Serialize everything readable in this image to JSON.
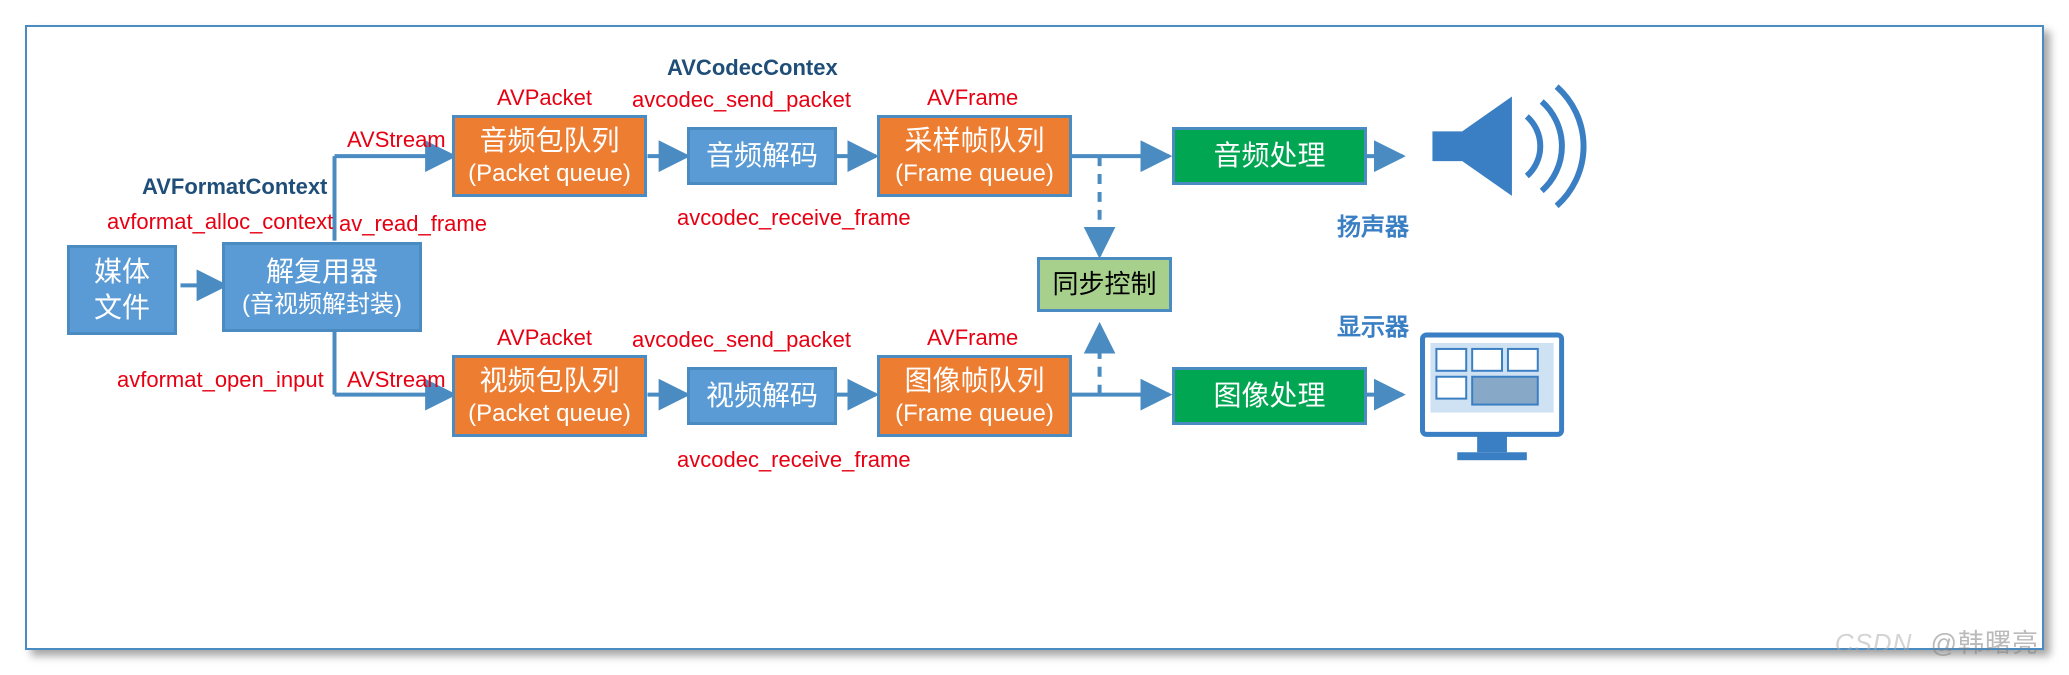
{
  "labels": {
    "avformatcontext": "AVFormatContext",
    "avformat_alloc_context": "avformat_alloc_context",
    "avformat_open_input": "avformat_open_input",
    "av_read_frame": "av_read_frame",
    "avstream_top": "AVStream",
    "avstream_bot": "AVStream",
    "avpacket_top": "AVPacket",
    "avpacket_bot": "AVPacket",
    "avcodeccontext": "AVCodecContex",
    "avcodec_send_packet_top": "avcodec_send_packet",
    "avcodec_send_packet_bot": "avcodec_send_packet",
    "avframe_top": "AVFrame",
    "avframe_bot": "AVFrame",
    "avcodec_receive_frame_top": "avcodec_receive_frame",
    "avcodec_receive_frame_bot": "avcodec_receive_frame",
    "speaker": "扬声器",
    "display": "显示器"
  },
  "boxes": {
    "media_file_l1": "媒体",
    "media_file_l2": "文件",
    "demux_l1": "解复用器",
    "demux_l2": "(音视频解封装)",
    "audio_pkt_l1": "音频包队列",
    "audio_pkt_l2": "(Packet queue)",
    "audio_decode": "音频解码",
    "audio_frame_l1": "采样帧队列",
    "audio_frame_l2": "(Frame queue)",
    "audio_proc": "音频处理",
    "video_pkt_l1": "视频包队列",
    "video_pkt_l2": "(Packet queue)",
    "video_decode": "视频解码",
    "video_frame_l1": "图像帧队列",
    "video_frame_l2": "(Frame queue)",
    "video_proc": "图像处理",
    "sync": "同步控制"
  },
  "watermark": {
    "csdn": "CSDN",
    "author": "@韩曙亮"
  }
}
